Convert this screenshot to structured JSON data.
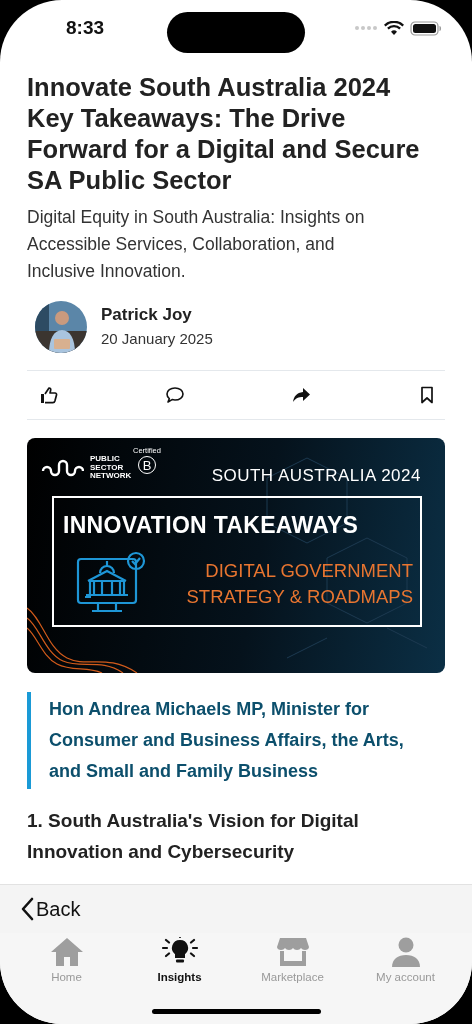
{
  "status_bar": {
    "time": "8:33"
  },
  "article": {
    "title": "Innovate South Australia 2024 Key Takeaways: The Drive Forward for a Digital and Secure SA Public Sector",
    "subtitle": "Digital Equity in South Australia: Insights on Accessible Services, Collaboration, and Inclusive Innovation.",
    "author": {
      "name": "Patrick Joy",
      "date": "20 January 2025"
    },
    "actions": [
      {
        "kind": "like"
      },
      {
        "kind": "comment"
      },
      {
        "kind": "share"
      },
      {
        "kind": "bookmark"
      }
    ],
    "banner": {
      "logo_lines": [
        "PUBLIC",
        "SECTOR",
        "NETWORK"
      ],
      "badge_top": "Certified",
      "badge_letter": "B",
      "region": "SOUTH AUSTRALIA 2024",
      "headline": "INNOVATION TAKEAWAYS",
      "topic_lines": [
        "DIGITAL GOVERNMENT",
        "STRATEGY & ROADMAPS"
      ]
    },
    "quote": "Hon Andrea Michaels MP, Minister for Consumer and Business Affairs, the Arts, and Small and Family Business",
    "section_heading": "1. South Australia's Vision for Digital Innovation and Cybersecurity"
  },
  "nav_bar": {
    "back": "Back"
  },
  "tab_bar": [
    {
      "kind": "home",
      "label": "Home",
      "selected": false
    },
    {
      "kind": "insights",
      "label": "Insights",
      "selected": true
    },
    {
      "kind": "marketplace",
      "label": "Marketplace",
      "selected": false
    },
    {
      "kind": "account",
      "label": "My account",
      "selected": false
    }
  ]
}
